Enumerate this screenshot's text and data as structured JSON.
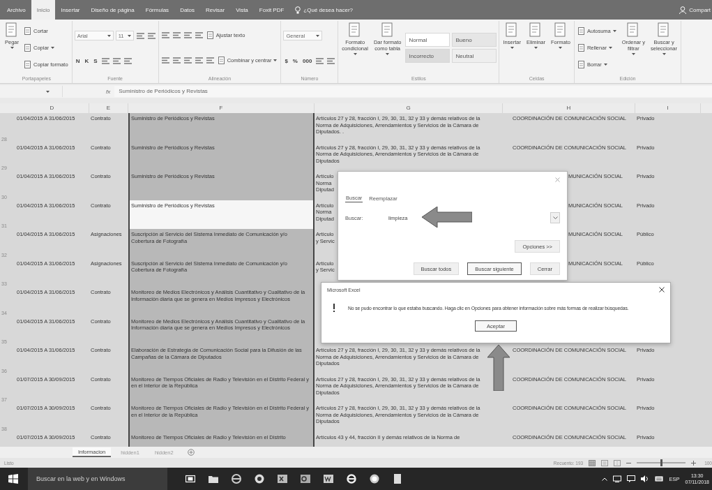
{
  "ribbon_tabs": [
    {
      "label": "Archivo",
      "selected": false
    },
    {
      "label": "Inicio",
      "selected": true
    },
    {
      "label": "Insertar",
      "selected": false
    },
    {
      "label": "Diseño de página",
      "selected": false
    },
    {
      "label": "Fórmulas",
      "selected": false
    },
    {
      "label": "Datos",
      "selected": false
    },
    {
      "label": "Revisar",
      "selected": false
    },
    {
      "label": "Vista",
      "selected": false
    },
    {
      "label": "Foxit PDF",
      "selected": false
    }
  ],
  "tell_me": "¿Qué desea hacer?",
  "share": "Compart",
  "ribbon_groups": [
    {
      "label": "Portapapeles",
      "blocks": [
        {
          "kind": "large",
          "label": "Pegar",
          "menu": true
        },
        {
          "kind": "stack",
          "lines": [
            {
              "items": [
                {
                  "kind": "small",
                  "label": "Cortar",
                  "menu": false
                }
              ]
            },
            {
              "items": [
                {
                  "kind": "small",
                  "label": "Copiar",
                  "menu": true
                }
              ]
            },
            {
              "items": [
                {
                  "kind": "small",
                  "label": "Copiar formato",
                  "menu": false
                }
              ]
            }
          ]
        }
      ]
    },
    {
      "label": "Fuente",
      "blocks": [
        {
          "kind": "stack",
          "lines": [
            {
              "items": [
                {
                  "kind": "combo",
                  "value": "Arial"
                },
                {
                  "kind": "combo",
                  "value": "11"
                },
                {
                  "kind": "tool"
                },
                {
                  "kind": "tool"
                }
              ]
            },
            {
              "items": [
                {
                  "kind": "letter",
                  "label": "N"
                },
                {
                  "kind": "letter",
                  "label": "K"
                },
                {
                  "kind": "letter",
                  "label": "S"
                },
                {
                  "kind": "tool"
                },
                {
                  "kind": "tool"
                },
                {
                  "kind": "tool"
                }
              ]
            }
          ]
        }
      ]
    },
    {
      "label": "Alineación",
      "blocks": [
        {
          "kind": "stack",
          "lines": [
            {
              "items": [
                {
                  "kind": "tool"
                },
                {
                  "kind": "tool"
                },
                {
                  "kind": "tool"
                },
                {
                  "kind": "tool"
                },
                {
                  "kind": "small",
                  "label": "Ajustar texto",
                  "menu": false
                }
              ]
            },
            {
              "items": [
                {
                  "kind": "tool"
                },
                {
                  "kind": "tool"
                },
                {
                  "kind": "tool"
                },
                {
                  "kind": "tool"
                },
                {
                  "kind": "tool"
                },
                {
                  "kind": "small",
                  "label": "Combinar y centrar",
                  "menu": true
                }
              ]
            }
          ]
        }
      ]
    },
    {
      "label": "Número",
      "blocks": [
        {
          "kind": "stack",
          "lines": [
            {
              "items": [
                {
                  "kind": "combo",
                  "value": "General"
                }
              ]
            },
            {
              "items": [
                {
                  "kind": "letter",
                  "label": "$"
                },
                {
                  "kind": "letter",
                  "label": "%"
                },
                {
                  "kind": "letter",
                  "label": "000"
                },
                {
                  "kind": "tool"
                },
                {
                  "kind": "tool"
                }
              ]
            }
          ]
        }
      ]
    },
    {
      "label": "Estilos",
      "blocks": [
        {
          "kind": "large",
          "label": "Formato\ncondicional",
          "menu": true
        },
        {
          "kind": "large",
          "label": "Dar formato\ncomo tabla",
          "menu": true
        },
        {
          "kind": "styles",
          "cells": [
            {
              "label": "Normal",
              "color": "#ffffff"
            },
            {
              "label": "Bueno",
              "color": "#e6e6e6"
            },
            {
              "label": "Incorrecto",
              "color": "#dcdcdc"
            },
            {
              "label": "Neutral",
              "color": "#eeeeee"
            }
          ]
        }
      ]
    },
    {
      "label": "Celdas",
      "blocks": [
        {
          "kind": "large",
          "label": "Insertar",
          "menu": true
        },
        {
          "kind": "large",
          "label": "Eliminar",
          "menu": true
        },
        {
          "kind": "large",
          "label": "Formato",
          "menu": true
        }
      ]
    },
    {
      "label": "Edición",
      "blocks": [
        {
          "kind": "stack",
          "lines": [
            {
              "items": [
                {
                  "kind": "small",
                  "label": "Autosuma",
                  "menu": true
                }
              ]
            },
            {
              "items": [
                {
                  "kind": "small",
                  "label": "Rellenar",
                  "menu": true
                }
              ]
            },
            {
              "items": [
                {
                  "kind": "small",
                  "label": "Borrar",
                  "menu": true
                }
              ]
            }
          ]
        },
        {
          "kind": "large",
          "label": "Ordenar y\nfiltrar",
          "menu": true
        },
        {
          "kind": "large",
          "label": "Buscar y\nseleccionar",
          "menu": true
        }
      ]
    }
  ],
  "formula_bar": {
    "function_button": "fx",
    "value": "Suministro de Periódicos y Revistas"
  },
  "columns": [
    "D",
    "E",
    "F",
    "G",
    "H",
    "I"
  ],
  "rows": [
    {
      "num": "28",
      "d": "01/04/2015 A 31/06/2015",
      "e": "Contrato",
      "f": "Suministro de Periódicos y Revistas",
      "active": false,
      "covered": false,
      "g": "Artículos 27 y 28, fracción I, 29, 30, 31, 32 y 33 y demás relativos de la Norma de Adquisiciones, Arrendamientos y Servicios de la Cámara de Diputados. .",
      "h": "COORDINACIÓN DE COMUNICACIÓN SOCIAL",
      "i": "Privado"
    },
    {
      "num": "29",
      "d": "01/04/2015 A 31/06/2015",
      "e": "Contrato",
      "f": "Suministro de Periódicos y Revistas",
      "active": false,
      "covered": false,
      "g": "Artículos 27 y 28, fracción I, 29, 30, 31, 32 y 33 y demás relativos de la Norma de Adquisiciones, Arrendamientos y Servicios de la Cámara de Diputados",
      "h": "COORDINACIÓN DE COMUNICACIÓN SOCIAL",
      "i": "Privado"
    },
    {
      "num": "30",
      "d": "01/04/2015 A 31/06/2015",
      "e": "Contrato",
      "f": "Suministro de Periódicos y Revistas",
      "active": false,
      "covered": true,
      "g": "Artículo\nNorma\nDiputad",
      "h": "MUNICACIÓN SOCIAL",
      "i": "Privado"
    },
    {
      "num": "31",
      "d": "01/04/2015 A 31/06/2015",
      "e": "Contrato",
      "f": "Suministro de Periódicos y Revistas",
      "active": true,
      "covered": true,
      "g": "Artículo\nNorma\nDiputad",
      "h": "MUNICACIÓN SOCIAL",
      "i": "Privado"
    },
    {
      "num": "32",
      "d": "01/04/2015 A 31/06/2015",
      "e": "Asignaciones",
      "f": "Suscripción al Servicio del Sistema Inmediato de Comunicación y/o Cobertura de Fotografía",
      "active": false,
      "covered": true,
      "g": "Artículo\ny Servic",
      "h": "MUNICACIÓN SOCIAL",
      "i": "Público"
    },
    {
      "num": "33",
      "d": "01/04/2015 A 31/06/2015",
      "e": "Asignaciones",
      "f": "Suscripción al Servicio del Sistema Inmediato de Comunicación y/o Cobertura de Fotografía",
      "active": false,
      "covered": true,
      "g": "Artículo\ny Servic",
      "h": "MUNICACIÓN SOCIAL",
      "i": "Público"
    },
    {
      "num": "34",
      "d": "01/04/2015 A 31/06/2015",
      "e": "Contrato",
      "f": "Monitoreo de Medios Electrónicos y Análisis Cuantitativo y Cualitativo de la Información diaria que se genera en Medios Impresos y Electrónicos",
      "active": false
    },
    {
      "num": "35",
      "d": "01/04/2015 A 31/06/2015",
      "e": "Contrato",
      "f": "Monitoreo de Medios Electrónicos y Análisis Cuantitativo y Cualitativo de la Información diaria que se genera en Medios Impresos y Electrónicos",
      "active": false
    },
    {
      "num": "36",
      "d": "01/04/2015 A 31/06/2015",
      "e": "Contrato",
      "f": "Elaboración de Estrategia de Comunicación Social para la Difusión de las Campañas de la Cámara de Diputados",
      "active": false,
      "covered": false,
      "g": "Artículos 27 y 28, fracción I, 29, 30, 31, 32 y 33 y demás relativos de la Norma de Adquisiciones, Arrendamientos y Servicios de la Cámara de Diputados",
      "h": "COORDINACIÓN DE COMUNICACIÓN SOCIAL",
      "i": "Privado"
    },
    {
      "num": "37",
      "d": "01/07/2015 A 30/09/2015",
      "e": "Contrato",
      "f": "Monitoreo de Tiempos Oficiales de Radio y Televisión en el Distrito Federal y en el Interior de la República",
      "active": false,
      "covered": false,
      "g": "Artículos 27 y 28, fracción I, 29, 30, 31, 32 y 33 y demás relativos de la Norma de Adquisiciones, Arrendamientos y Servicios de la Cámara de Diputados",
      "h": "COORDINACIÓN DE COMUNICACIÓN SOCIAL",
      "i": "Privado"
    },
    {
      "num": "38",
      "d": "01/07/2015 A 30/09/2015",
      "e": "Contrato",
      "f": "Monitoreo de Tiempos Oficiales de Radio y Televisión en el Distrito Federal y en el Interior de la República",
      "active": false,
      "covered": false,
      "g": "Artículos 27 y 28, fracción I, 29, 30, 31, 32 y 33 y demás relativos de la Norma de Adquisiciones, Arrendamientos y Servicios de la Cámara de Diputados",
      "h": "COORDINACIÓN DE COMUNICACIÓN SOCIAL",
      "i": "Privado"
    },
    {
      "d": "01/07/2015 A 30/09/2015",
      "e": "Contrato",
      "f": "Monitoreo de Tiempos Oficiales de Radio y Televisión en el Distrito",
      "active": false,
      "covered": false,
      "g": "Artículos 43 y 44, fracción II y demás relativos de la Norma de",
      "h": "COORDINACIÓN DE COMUNICACIÓN SOCIAL",
      "i": "Privado"
    }
  ],
  "find_dialog": {
    "tabs": [
      {
        "label": "Buscar",
        "selected": true
      },
      {
        "label": "Reemplazar",
        "selected": false
      }
    ],
    "field_label": "Buscar:",
    "field_value": "limpieza",
    "options_button": "Opciones >>",
    "buttons": [
      {
        "label": "Buscar todos",
        "default": false
      },
      {
        "label": "Buscar siguiente",
        "default": true
      },
      {
        "label": "Cerrar",
        "default": false
      }
    ]
  },
  "message_box": {
    "title": "Microsoft Excel",
    "message": "No se pudo encontrar lo que estaba buscando. Haga clic en Opciones para obtener información sobre más formas de realizar búsquedas.",
    "button": "Aceptar"
  },
  "sheet_tabs": [
    {
      "label": "Informacion",
      "selected": true
    },
    {
      "label": "hidden1",
      "selected": false
    },
    {
      "label": "hidden2",
      "selected": false
    }
  ],
  "status_bar": {
    "status": "Listo",
    "count": "Recuento: 193",
    "zoom": {
      "level": 0.5,
      "reading": "100"
    }
  },
  "taskbar": {
    "search": {
      "placeholder": "Buscar en la web y en Windows"
    },
    "language": "ESP",
    "time": "13:30",
    "date": "07/11/2018"
  }
}
